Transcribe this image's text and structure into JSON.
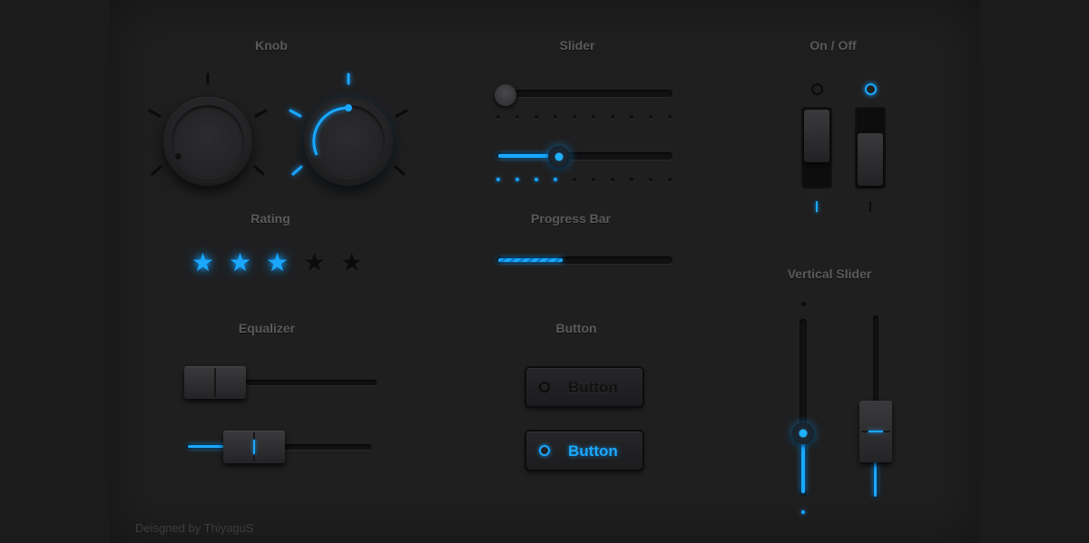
{
  "titles": {
    "knob": "Knob",
    "slider": "Slider",
    "onoff": "On / Off",
    "rating": "Rating",
    "progress": "Progress Bar",
    "vertical_slider": "Vertical Slider",
    "equalizer": "Equalizer",
    "button": "Button"
  },
  "credit": "Deisgned by ThiyaguS",
  "buttons": [
    {
      "label": "Button",
      "active": false
    },
    {
      "label": "Button",
      "active": true
    }
  ],
  "rating": {
    "value": 3,
    "max": 5
  },
  "sliders": [
    {
      "value": 0.0,
      "active": false
    },
    {
      "value": 0.35,
      "active": true
    }
  ],
  "progress": {
    "value": 0.38
  },
  "toggles": [
    {
      "state": "off"
    },
    {
      "state": "on"
    }
  ],
  "knobs": [
    {
      "active": false
    },
    {
      "active": true
    }
  ],
  "colors": {
    "accent": "#1aa8ff",
    "panel": "#1f1f20"
  },
  "icons": [
    "star-icon",
    "ring-indicator-icon"
  ]
}
